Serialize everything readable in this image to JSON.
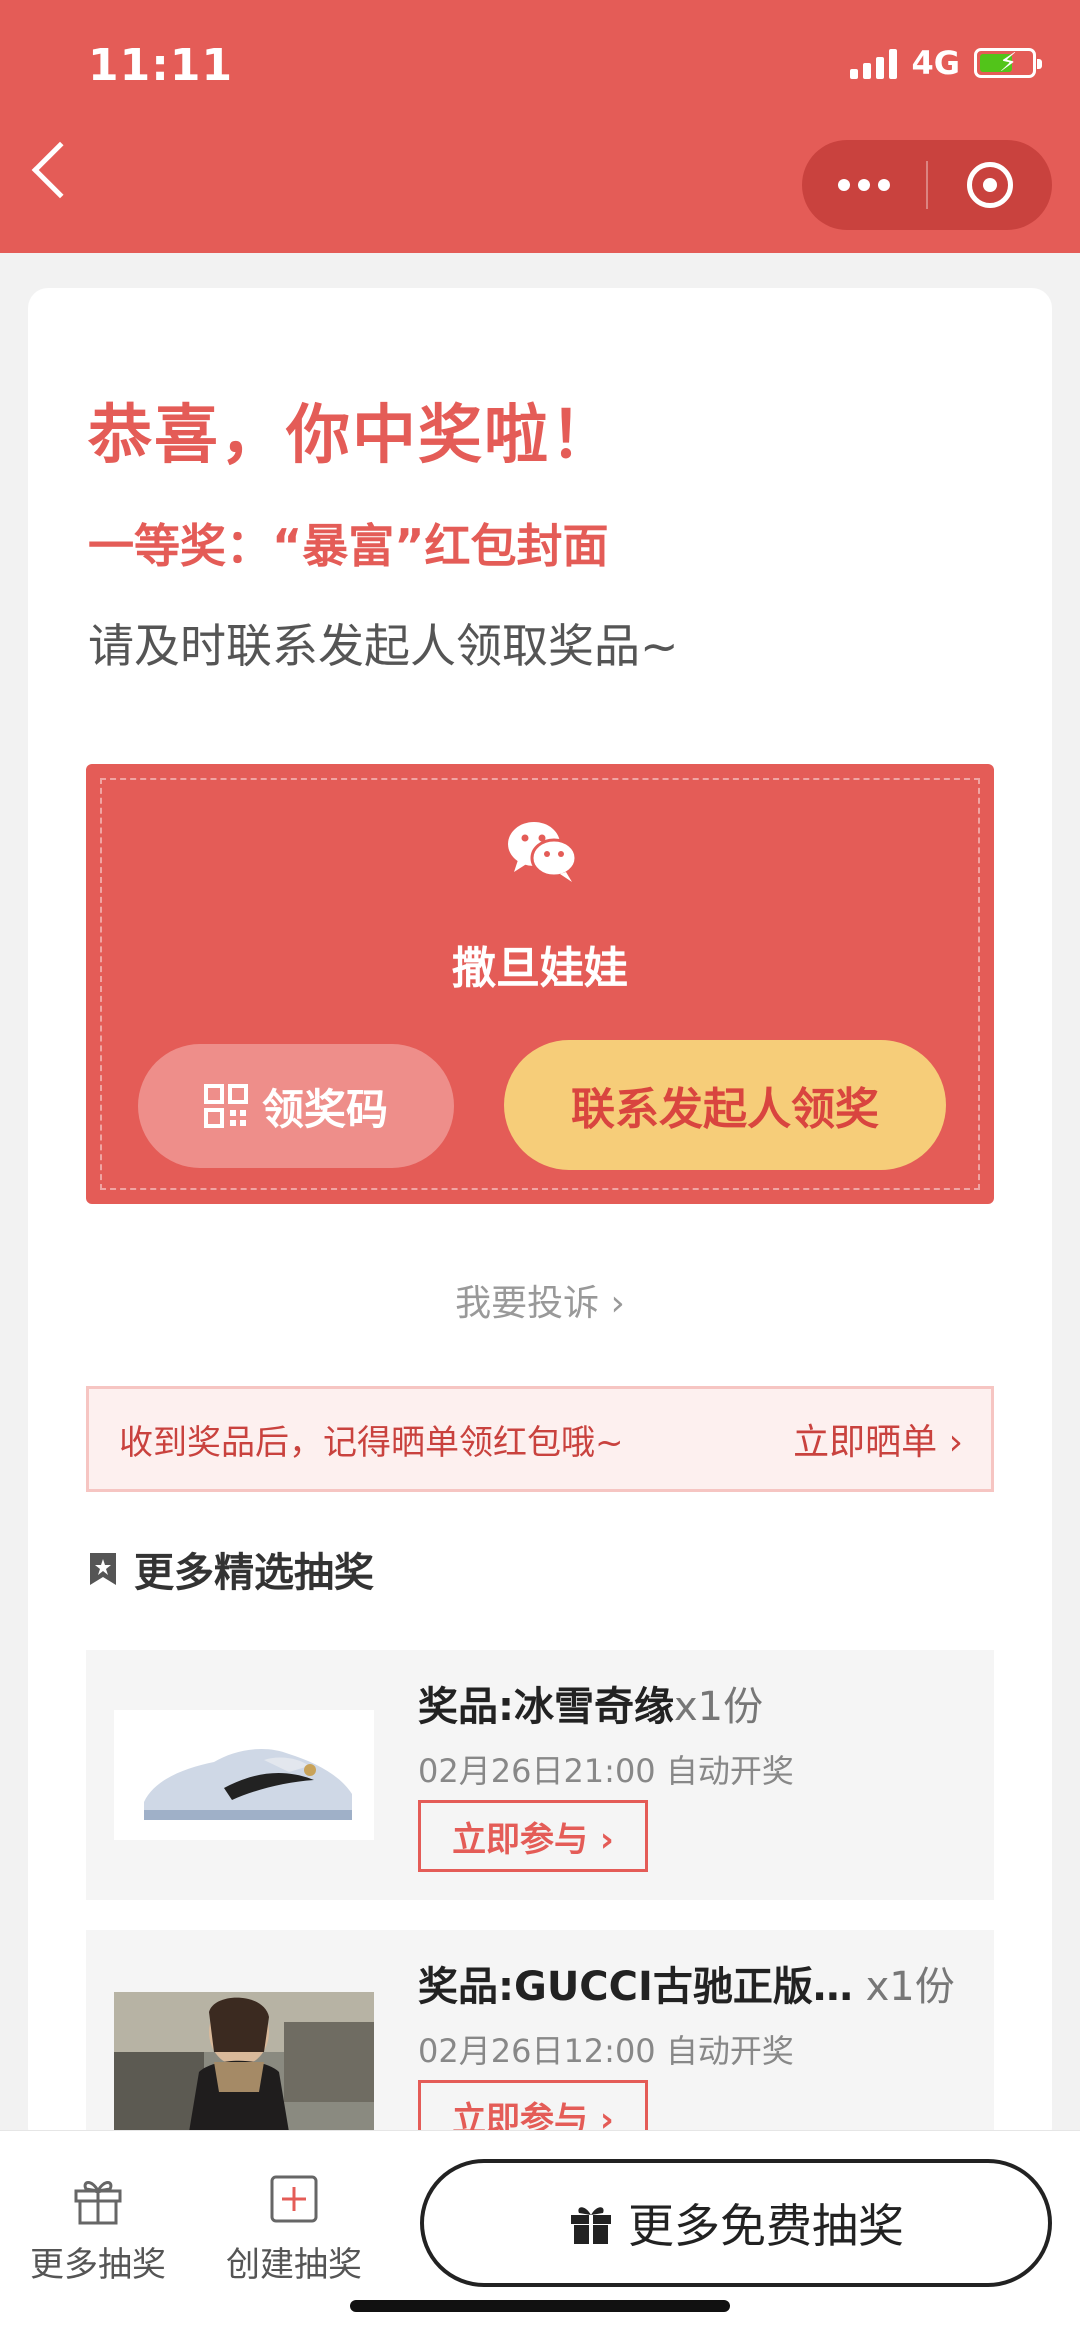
{
  "status_bar": {
    "time": "11:11",
    "network": "4G"
  },
  "header": {
    "back_label": "",
    "more_icon": "more-dots-icon",
    "close_icon": "target-close-icon"
  },
  "result": {
    "title": "恭喜，你中奖啦！",
    "prize": "一等奖：“暴富”红包封面",
    "tip": "请及时联系发起人领取奖品~"
  },
  "organizer": {
    "name": "撒旦娃娃",
    "code_button": "领奖码",
    "contact_button": "联系发起人领奖"
  },
  "complain_link": "我要投诉 ›",
  "share": {
    "text": "收到奖品后，记得晒单领红包哦~",
    "link": "立即晒单 ›"
  },
  "more_section": {
    "title": "更多精选抽奖"
  },
  "lotteries": [
    {
      "name": "奖品:冰雪奇缘",
      "count": "x1份",
      "time": "02月26日21:00 自动开奖",
      "button": "立即参与 ›"
    },
    {
      "name": "奖品:GUCCI古驰正版…",
      "count": " x1份",
      "time": "02月26日12:00 自动开奖",
      "button": "立即参与 ›"
    }
  ],
  "bottom_bar": {
    "more_lottery": "更多抽奖",
    "create_lottery": "创建抽奖",
    "free_button": "更多免费抽奖"
  },
  "colors": {
    "primary_red": "#e45c57",
    "gold": "#f6cd79"
  }
}
